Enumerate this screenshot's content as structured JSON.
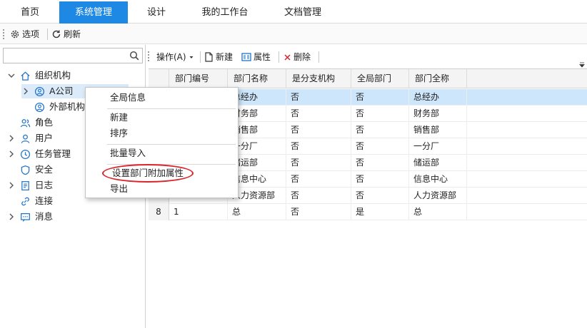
{
  "menubar": {
    "tabs": [
      {
        "label": "首页",
        "active": false
      },
      {
        "label": "系统管理",
        "active": true
      },
      {
        "label": "设计",
        "active": false
      },
      {
        "label": "我的工作台",
        "active": false
      },
      {
        "label": "文档管理",
        "active": false
      }
    ]
  },
  "toolbar": {
    "options_label": "选项",
    "refresh_label": "刷新"
  },
  "search": {
    "value": "",
    "placeholder": ""
  },
  "tree": {
    "items": [
      {
        "label": "组织机构",
        "icon": "home-icon",
        "expanded": true
      },
      {
        "label": "A公司",
        "icon": "org-icon",
        "selected": true
      },
      {
        "label": "外部机构",
        "icon": "org-icon"
      },
      {
        "label": "角色",
        "icon": "users-icon"
      },
      {
        "label": "用户",
        "icon": "user-icon"
      },
      {
        "label": "任务管理",
        "icon": "clock-icon"
      },
      {
        "label": "安全",
        "icon": "shield-icon"
      },
      {
        "label": "日志",
        "icon": "log-icon"
      },
      {
        "label": "连接",
        "icon": "link-icon"
      },
      {
        "label": "消息",
        "icon": "message-icon"
      }
    ]
  },
  "grid_toolbar": {
    "operate_label": "操作(A)",
    "new_label": "新建",
    "props_label": "属性",
    "delete_label": "删除"
  },
  "grid": {
    "columns": [
      "部门编号",
      "部门名称",
      "是分支机构",
      "全局部门",
      "部门全称"
    ],
    "rows": [
      {
        "num": "",
        "code": "",
        "name": "总经办",
        "branch": "否",
        "global": "否",
        "full": "总经办"
      },
      {
        "num": "",
        "code": "",
        "name": "财务部",
        "branch": "否",
        "global": "否",
        "full": "财务部"
      },
      {
        "num": "",
        "code": "",
        "name": "销售部",
        "branch": "否",
        "global": "否",
        "full": "销售部"
      },
      {
        "num": "",
        "code": "",
        "name": "一分厂",
        "branch": "否",
        "global": "否",
        "full": "一分厂"
      },
      {
        "num": "",
        "code": "",
        "name": "储运部",
        "branch": "否",
        "global": "否",
        "full": "储运部"
      },
      {
        "num": "",
        "code": "",
        "name": "信息中心",
        "branch": "否",
        "global": "否",
        "full": "信息中心"
      },
      {
        "num": "",
        "code": "",
        "name": "人力资源部",
        "branch": "否",
        "global": "否",
        "full": "人力资源部"
      },
      {
        "num": "8",
        "code": "1",
        "name": "总",
        "branch": "否",
        "global": "是",
        "full": "总"
      }
    ]
  },
  "context_menu": {
    "items": [
      "全局信息",
      "新建",
      "排序",
      "批量导入",
      "设置部门附加属性",
      "导出"
    ]
  },
  "colors": {
    "accent": "#1e88e5",
    "selection": "#cde6fb",
    "annotation": "#d9242a"
  }
}
